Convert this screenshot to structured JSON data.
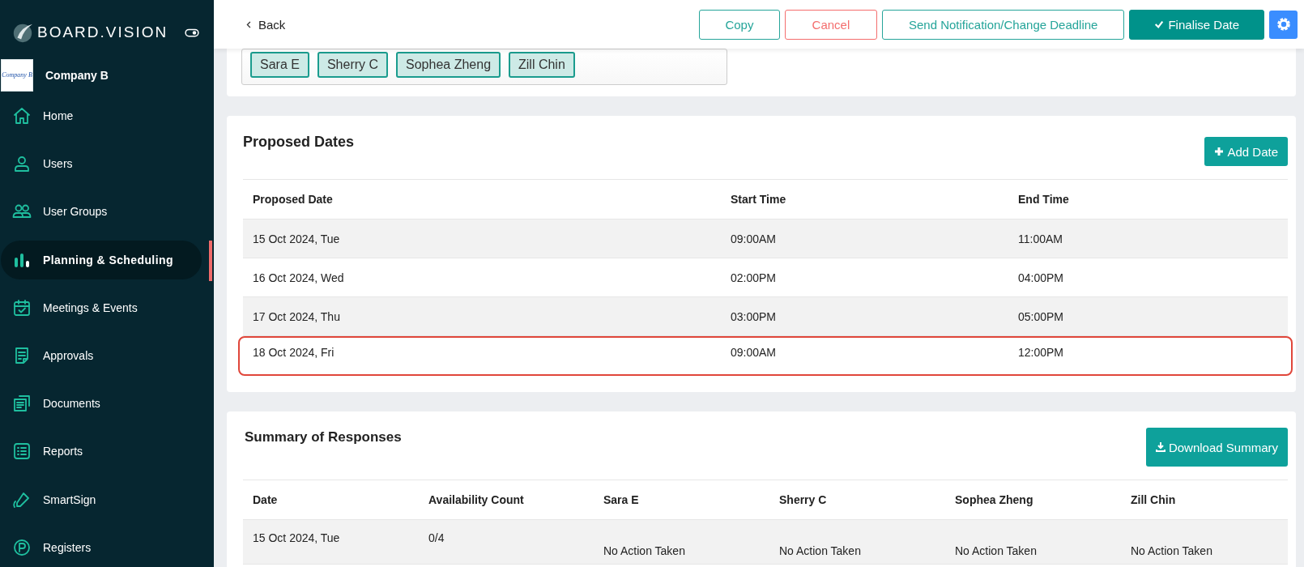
{
  "sidebar": {
    "brand": "BOARD.VISION",
    "company": {
      "logo_text": "Company B",
      "name": "Company B"
    },
    "items": [
      {
        "label": "Home",
        "selected": false
      },
      {
        "label": "Users",
        "selected": false
      },
      {
        "label": "User Groups",
        "selected": false
      },
      {
        "label": "Planning & Scheduling",
        "selected": true
      },
      {
        "label": "Meetings & Events",
        "selected": false
      },
      {
        "label": "Approvals",
        "selected": false
      },
      {
        "label": "Documents",
        "selected": false
      },
      {
        "label": "Reports",
        "selected": false
      },
      {
        "label": "SmartSign",
        "selected": false
      },
      {
        "label": "Registers",
        "selected": false
      }
    ]
  },
  "header": {
    "back": "Back",
    "buttons": [
      {
        "label": "Copy",
        "kind": "outline"
      },
      {
        "label": "Cancel",
        "kind": "danger"
      },
      {
        "label": "Send Notification/Change Deadline",
        "kind": "outline"
      },
      {
        "label": "Finalise Date",
        "kind": "primary"
      }
    ]
  },
  "participants": [
    "Sara E",
    "Sherry C",
    "Sophea Zheng",
    "Zill Chin"
  ],
  "proposed_dates": {
    "title": "Proposed Dates",
    "add_button": "Add Date",
    "columns": [
      "Proposed Date",
      "Start Time",
      "End Time"
    ],
    "rows": [
      {
        "date": "15 Oct 2024, Tue",
        "start": "09:00AM",
        "end": "11:00AM",
        "selected": false
      },
      {
        "date": "16 Oct 2024, Wed",
        "start": "02:00PM",
        "end": "04:00PM",
        "selected": false
      },
      {
        "date": "17 Oct 2024, Thu",
        "start": "03:00PM",
        "end": "05:00PM",
        "selected": false
      },
      {
        "date": "18 Oct 2024, Fri",
        "start": "09:00AM",
        "end": "12:00PM",
        "selected": true
      }
    ]
  },
  "summary": {
    "title": "Summary of Responses",
    "download_button": "Download Summary",
    "columns": [
      "Date",
      "Availability Count",
      "Sara E",
      "Sherry C",
      "Sophea Zheng",
      "Zill Chin"
    ],
    "rows": [
      {
        "date": "15 Oct 2024, Tue",
        "count": "0/4",
        "responses": [
          "No Action Taken",
          "No Action Taken",
          "No Action Taken",
          "No Action Taken"
        ]
      }
    ]
  }
}
